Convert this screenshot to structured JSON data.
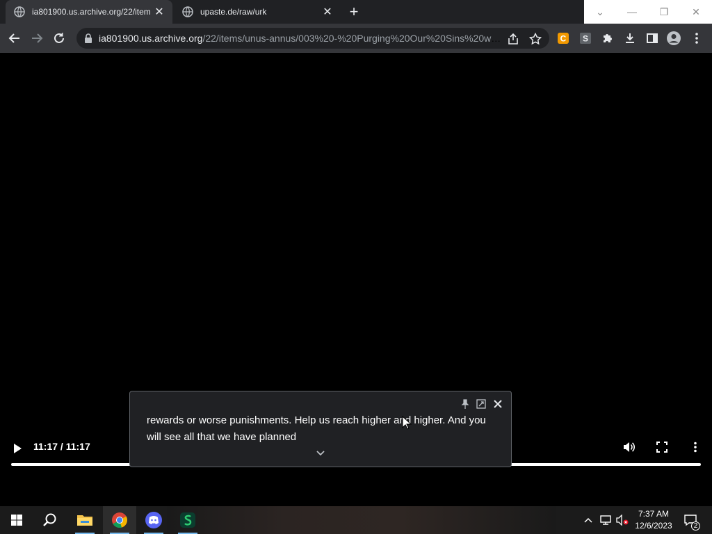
{
  "browser": {
    "tabs": [
      {
        "title": "ia801900.us.archive.org/22/item",
        "active": true
      },
      {
        "title": "upaste.de/raw/urk",
        "active": false
      }
    ],
    "address": {
      "host": "ia801900.us.archive.org",
      "path": "/22/items/unus-annus/003%20-%20Purging%20Our%20Sins%20wit..."
    },
    "extensions": [
      "coupon-extension-icon",
      "s-extension-icon",
      "puzzle-icon"
    ]
  },
  "player": {
    "time_display": "11:17 / 11:17",
    "progress": 1.0
  },
  "caption": {
    "text": "rewards or worse punishments. Help us reach higher and higher. And you will see all that we have planned"
  },
  "taskbar": {
    "clock_time": "7:37 AM",
    "clock_date": "12/6/2023",
    "notification_count": "2"
  },
  "colors": {
    "tabbar_bg": "#202124",
    "toolbar_bg": "#35363a",
    "video_bg": "#000000",
    "taskbar_bg": "#1b1b1b",
    "accent": "#76b9ed"
  }
}
